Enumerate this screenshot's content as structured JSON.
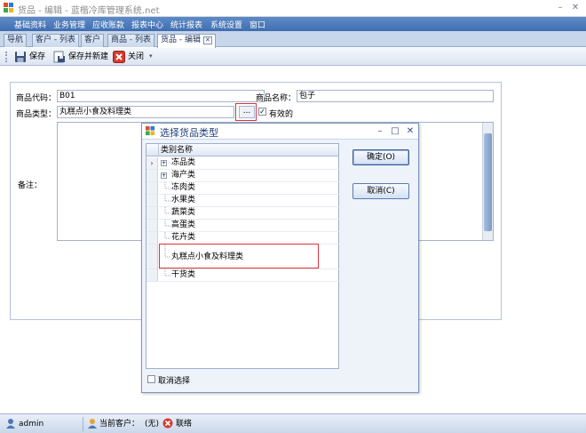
{
  "window": {
    "title": "货品 - 编辑 - 蓝楷冷库管理系统.net",
    "min_icon": "minimize-icon",
    "max_icon": "maximize-icon",
    "close_icon": "close-icon"
  },
  "menu": [
    "基础资料",
    "业务管理",
    "应收账款",
    "报表中心",
    "统计报表",
    "系统设置",
    "窗口"
  ],
  "tabs": [
    {
      "label": "导航"
    },
    {
      "label": "客户 - 列表"
    },
    {
      "label": "客户"
    },
    {
      "label": "商品 - 列表"
    },
    {
      "label": "货品 - 编辑",
      "active": true
    }
  ],
  "toolbar": {
    "save": "保存",
    "save_new": "保存并新建",
    "close": "关闭"
  },
  "form": {
    "code_label": "商品代码：",
    "code_value": "B01",
    "name_label": "商品名称：",
    "name_value": "包子",
    "type_label": "商品类型：",
    "type_value": "丸糕点小食及料理类",
    "ellipsis": "...",
    "valid_label": "有效的",
    "valid_checked": true,
    "memo_label": "备注："
  },
  "dialog": {
    "title": "选择货品类型",
    "column_header": "类别名称",
    "rows": [
      {
        "label": "冻品类",
        "expandable": true,
        "current": true
      },
      {
        "label": "海产类",
        "expandable": true
      },
      {
        "label": "冻肉类"
      },
      {
        "label": "水果类"
      },
      {
        "label": "蔬菜类"
      },
      {
        "label": "高蛋类"
      },
      {
        "label": "花卉类"
      },
      {
        "label": "丸糕点小食及料理类"
      },
      {
        "label": "干货类"
      }
    ],
    "ok": "确定(O)",
    "cancel": "取消(C)",
    "uncheck_label": "取消选择"
  },
  "status": {
    "user": "admin",
    "customer_label": "当前客户：",
    "customer_value": "(无)",
    "contact": "联络"
  },
  "colors": {
    "menubar": "#4a78b8",
    "highlight_red": "#d9353a"
  }
}
